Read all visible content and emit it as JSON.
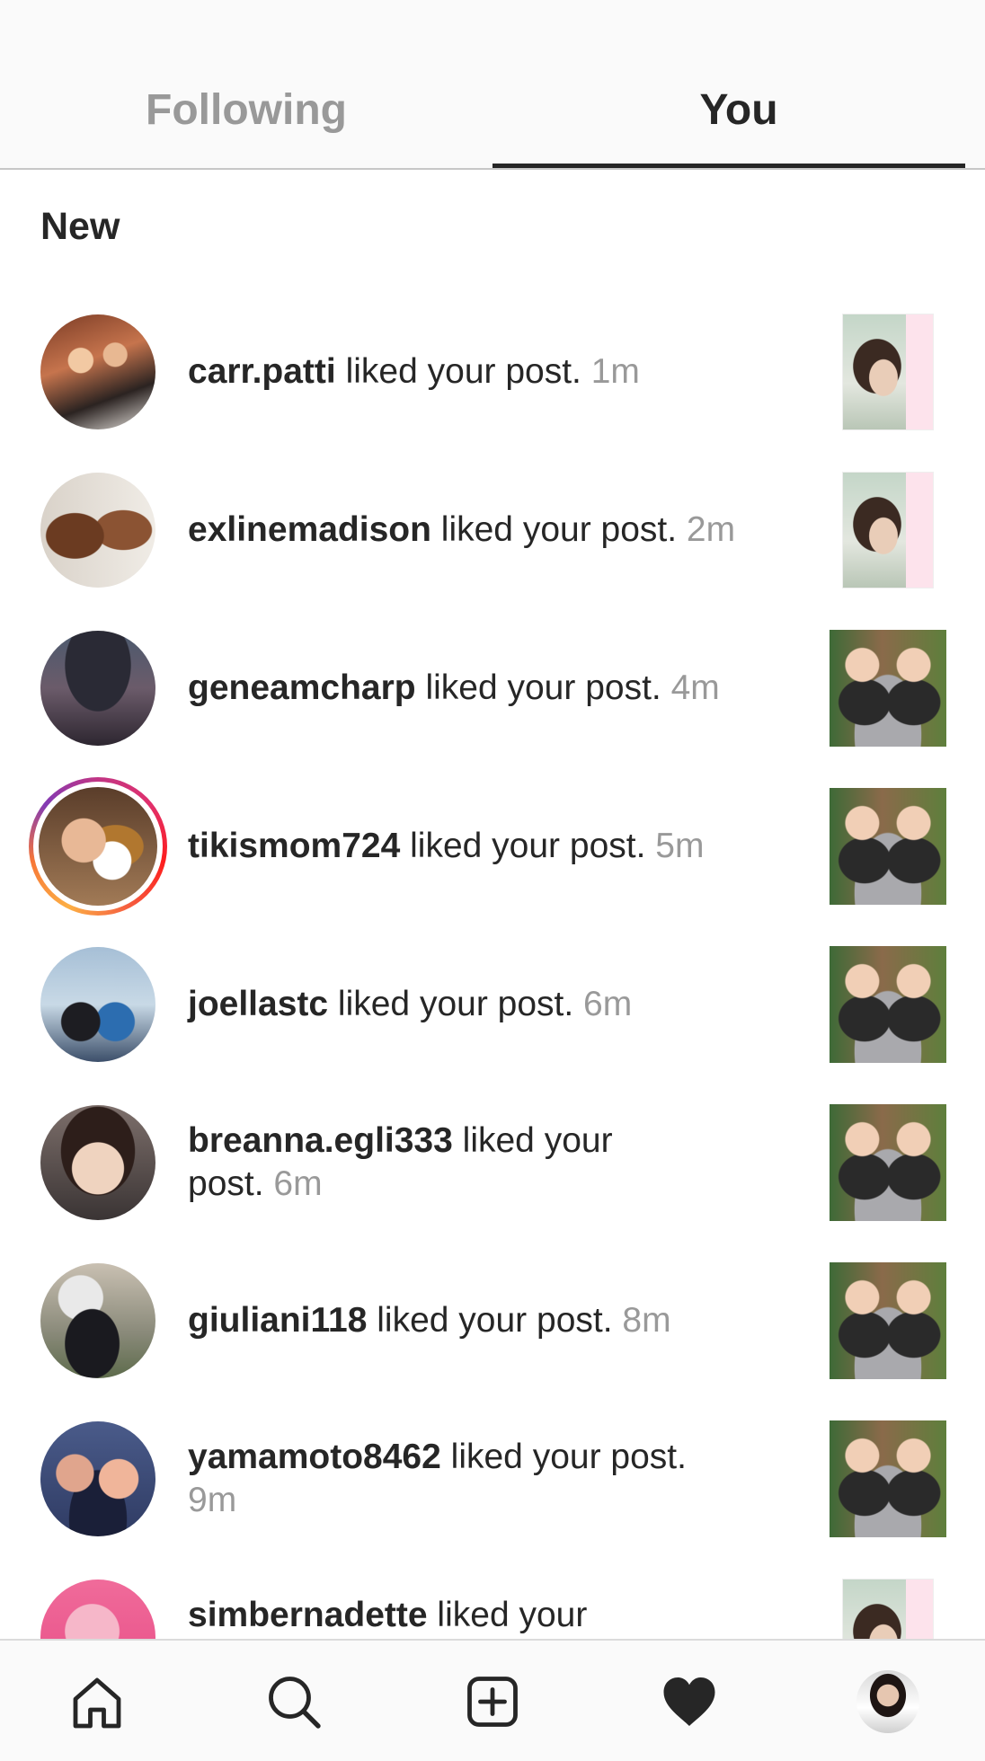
{
  "tabs": {
    "following_label": "Following",
    "you_label": "You",
    "active": "You"
  },
  "section": {
    "title": "New"
  },
  "notifications": [
    {
      "user": "carr.patti",
      "action": " liked your post. ",
      "time": "1m",
      "thumb": "portrait",
      "story": false
    },
    {
      "user": "exlinemadison",
      "action": " liked your post. ",
      "time": "2m",
      "thumb": "portrait",
      "story": false
    },
    {
      "user": "geneamcharp",
      "action": " liked your post. ",
      "time": "4m",
      "thumb": "square",
      "story": false
    },
    {
      "user": "tikismom724",
      "action": " liked your post. ",
      "time": "5m",
      "thumb": "square",
      "story": true
    },
    {
      "user": "joellastc",
      "action": " liked your post. ",
      "time": "6m",
      "thumb": "square",
      "story": false
    },
    {
      "user": "breanna.egli333",
      "action": " liked your post. ",
      "time": "6m",
      "thumb": "square",
      "story": false
    },
    {
      "user": "giuliani118",
      "action": " liked your post. ",
      "time": "8m",
      "thumb": "square",
      "story": false
    },
    {
      "user": "yamamoto8462",
      "action": " liked your post. ",
      "time": "9m",
      "thumb": "square",
      "story": false
    },
    {
      "user": "simbernadette",
      "action": " liked your",
      "time": "",
      "thumb": "portrait",
      "story": false
    }
  ],
  "bottom_nav": {
    "items": [
      "home-icon",
      "search-icon",
      "add-post-icon",
      "heart-icon",
      "profile-avatar"
    ],
    "active": "heart-icon"
  },
  "colors": {
    "text": "#262626",
    "muted": "#999999",
    "tab_bg": "#fafafa"
  }
}
